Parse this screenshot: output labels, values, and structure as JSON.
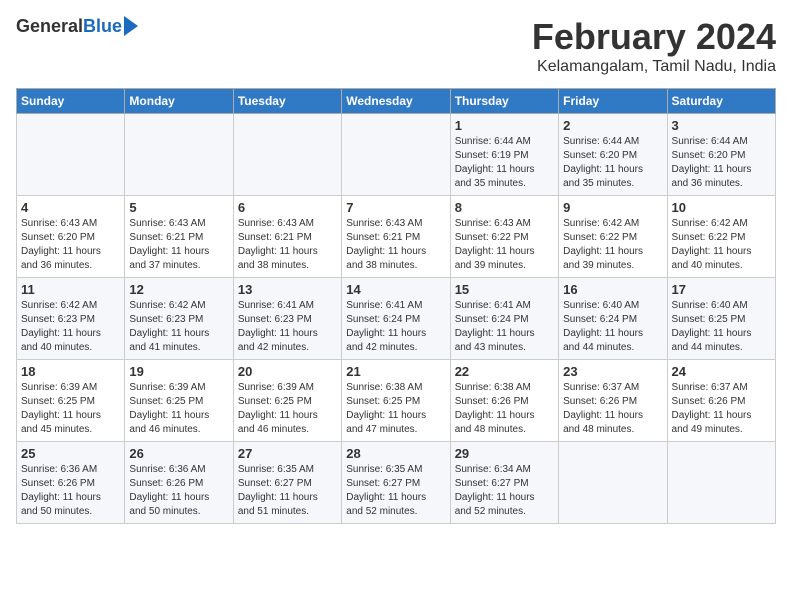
{
  "logo": {
    "general": "General",
    "blue": "Blue"
  },
  "title": "February 2024",
  "location": "Kelamangalam, Tamil Nadu, India",
  "headers": [
    "Sunday",
    "Monday",
    "Tuesday",
    "Wednesday",
    "Thursday",
    "Friday",
    "Saturday"
  ],
  "weeks": [
    [
      {
        "day": "",
        "info": ""
      },
      {
        "day": "",
        "info": ""
      },
      {
        "day": "",
        "info": ""
      },
      {
        "day": "",
        "info": ""
      },
      {
        "day": "1",
        "info": "Sunrise: 6:44 AM\nSunset: 6:19 PM\nDaylight: 11 hours\nand 35 minutes."
      },
      {
        "day": "2",
        "info": "Sunrise: 6:44 AM\nSunset: 6:20 PM\nDaylight: 11 hours\nand 35 minutes."
      },
      {
        "day": "3",
        "info": "Sunrise: 6:44 AM\nSunset: 6:20 PM\nDaylight: 11 hours\nand 36 minutes."
      }
    ],
    [
      {
        "day": "4",
        "info": "Sunrise: 6:43 AM\nSunset: 6:20 PM\nDaylight: 11 hours\nand 36 minutes."
      },
      {
        "day": "5",
        "info": "Sunrise: 6:43 AM\nSunset: 6:21 PM\nDaylight: 11 hours\nand 37 minutes."
      },
      {
        "day": "6",
        "info": "Sunrise: 6:43 AM\nSunset: 6:21 PM\nDaylight: 11 hours\nand 38 minutes."
      },
      {
        "day": "7",
        "info": "Sunrise: 6:43 AM\nSunset: 6:21 PM\nDaylight: 11 hours\nand 38 minutes."
      },
      {
        "day": "8",
        "info": "Sunrise: 6:43 AM\nSunset: 6:22 PM\nDaylight: 11 hours\nand 39 minutes."
      },
      {
        "day": "9",
        "info": "Sunrise: 6:42 AM\nSunset: 6:22 PM\nDaylight: 11 hours\nand 39 minutes."
      },
      {
        "day": "10",
        "info": "Sunrise: 6:42 AM\nSunset: 6:22 PM\nDaylight: 11 hours\nand 40 minutes."
      }
    ],
    [
      {
        "day": "11",
        "info": "Sunrise: 6:42 AM\nSunset: 6:23 PM\nDaylight: 11 hours\nand 40 minutes."
      },
      {
        "day": "12",
        "info": "Sunrise: 6:42 AM\nSunset: 6:23 PM\nDaylight: 11 hours\nand 41 minutes."
      },
      {
        "day": "13",
        "info": "Sunrise: 6:41 AM\nSunset: 6:23 PM\nDaylight: 11 hours\nand 42 minutes."
      },
      {
        "day": "14",
        "info": "Sunrise: 6:41 AM\nSunset: 6:24 PM\nDaylight: 11 hours\nand 42 minutes."
      },
      {
        "day": "15",
        "info": "Sunrise: 6:41 AM\nSunset: 6:24 PM\nDaylight: 11 hours\nand 43 minutes."
      },
      {
        "day": "16",
        "info": "Sunrise: 6:40 AM\nSunset: 6:24 PM\nDaylight: 11 hours\nand 44 minutes."
      },
      {
        "day": "17",
        "info": "Sunrise: 6:40 AM\nSunset: 6:25 PM\nDaylight: 11 hours\nand 44 minutes."
      }
    ],
    [
      {
        "day": "18",
        "info": "Sunrise: 6:39 AM\nSunset: 6:25 PM\nDaylight: 11 hours\nand 45 minutes."
      },
      {
        "day": "19",
        "info": "Sunrise: 6:39 AM\nSunset: 6:25 PM\nDaylight: 11 hours\nand 46 minutes."
      },
      {
        "day": "20",
        "info": "Sunrise: 6:39 AM\nSunset: 6:25 PM\nDaylight: 11 hours\nand 46 minutes."
      },
      {
        "day": "21",
        "info": "Sunrise: 6:38 AM\nSunset: 6:25 PM\nDaylight: 11 hours\nand 47 minutes."
      },
      {
        "day": "22",
        "info": "Sunrise: 6:38 AM\nSunset: 6:26 PM\nDaylight: 11 hours\nand 48 minutes."
      },
      {
        "day": "23",
        "info": "Sunrise: 6:37 AM\nSunset: 6:26 PM\nDaylight: 11 hours\nand 48 minutes."
      },
      {
        "day": "24",
        "info": "Sunrise: 6:37 AM\nSunset: 6:26 PM\nDaylight: 11 hours\nand 49 minutes."
      }
    ],
    [
      {
        "day": "25",
        "info": "Sunrise: 6:36 AM\nSunset: 6:26 PM\nDaylight: 11 hours\nand 50 minutes."
      },
      {
        "day": "26",
        "info": "Sunrise: 6:36 AM\nSunset: 6:26 PM\nDaylight: 11 hours\nand 50 minutes."
      },
      {
        "day": "27",
        "info": "Sunrise: 6:35 AM\nSunset: 6:27 PM\nDaylight: 11 hours\nand 51 minutes."
      },
      {
        "day": "28",
        "info": "Sunrise: 6:35 AM\nSunset: 6:27 PM\nDaylight: 11 hours\nand 52 minutes."
      },
      {
        "day": "29",
        "info": "Sunrise: 6:34 AM\nSunset: 6:27 PM\nDaylight: 11 hours\nand 52 minutes."
      },
      {
        "day": "",
        "info": ""
      },
      {
        "day": "",
        "info": ""
      }
    ]
  ]
}
